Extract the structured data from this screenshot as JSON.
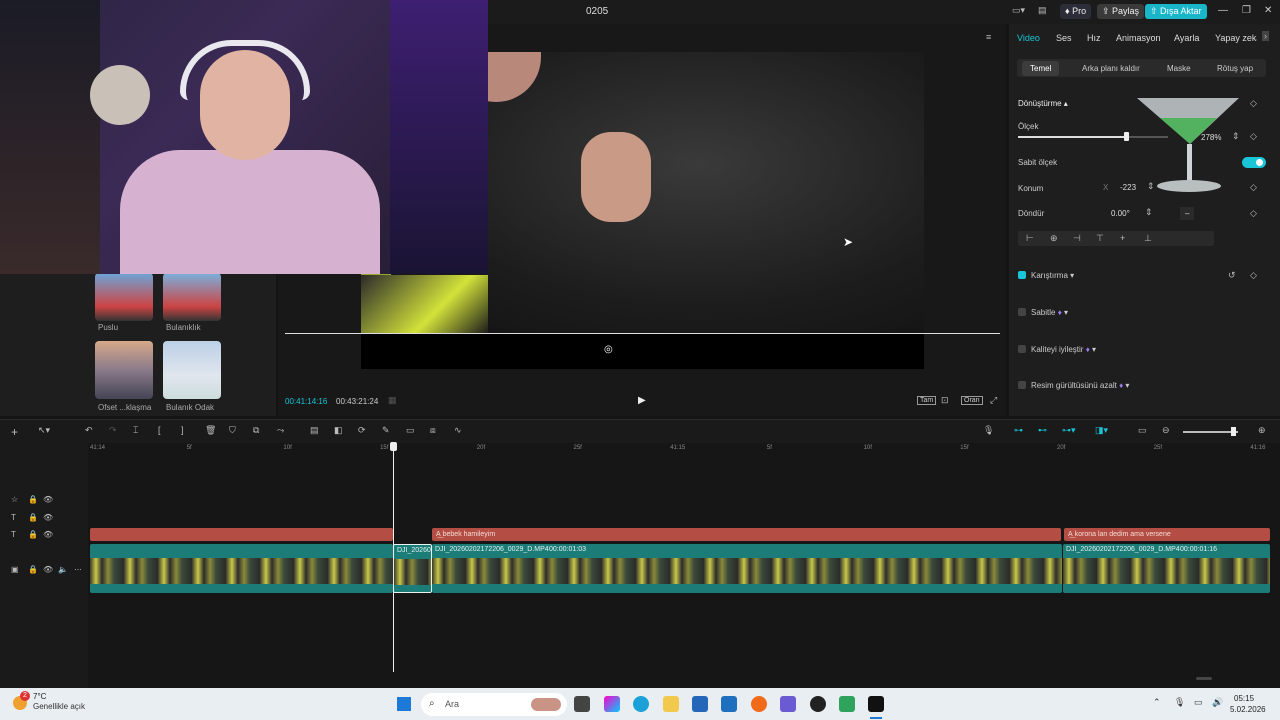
{
  "window": {
    "title": "0205",
    "pro_label": "Pro",
    "share_label": "Paylaş",
    "export_label": "Dışa Aktar"
  },
  "left_panel": {
    "items": [
      {
        "label": "Puslu"
      },
      {
        "label": "Bulanıklık"
      },
      {
        "label": "Ofset ...klaşma"
      },
      {
        "label": "Bulanık Odak"
      }
    ]
  },
  "player": {
    "time_current": "00:41:14:16",
    "time_total": "00:43:21:24",
    "controls": {
      "full": "Tam",
      "ratio": "Oran"
    }
  },
  "inspector": {
    "tabs": [
      "Video",
      "Ses",
      "Hız",
      "Animasyon",
      "Ayarla",
      "Yapay zekâ"
    ],
    "subtabs": [
      "Temel",
      "Arka planı kaldır",
      "Maske",
      "Rötuş yap"
    ],
    "transform_label": "Dönüştürme",
    "scale_label": "Ölçek",
    "scale_value": "278%",
    "scale_fraction": 0.72,
    "uniform_scale_label": "Sabit ölçek",
    "position_label": "Konum",
    "position_x_label": "X",
    "position_x": "-223",
    "rotate_label": "Döndür",
    "rotate_value": "0.00°",
    "rotate_dash": "–",
    "blend_label": "Karıştırma",
    "stabilize_label": "Sabitle",
    "enhance_label": "Kaliteyi iyileştir",
    "denoise_label": "Resim gürültüsünü azalt",
    "accent": "#19c5d6"
  },
  "timeline": {
    "ruler": [
      "41:14",
      "5f",
      "10f",
      "15f",
      "20f",
      "25f",
      "41:15",
      "5f",
      "10f",
      "15f",
      "20f",
      "25f",
      "41:16"
    ],
    "text_clips": [
      {
        "label": "bebek hamileyim"
      },
      {
        "label": "korona lan dedim ama versene"
      }
    ],
    "video_clips": [
      {
        "name": "DJI_20260",
        "duration": ""
      },
      {
        "name": "DJI_20260202172206_0029_D.MP4",
        "duration": "00:00:01:03"
      },
      {
        "name": "DJI_20260202172206_0029_D.MP4",
        "duration": "00:00:01:16"
      }
    ],
    "clip_color": "#1b7c78",
    "text_clip_color": "#b44d43"
  },
  "taskbar": {
    "temperature": "7°C",
    "weather": "Genellikle açık",
    "search_placeholder": "Ara",
    "time": "05:15",
    "date": "5.02.2026",
    "notification_badge": "2"
  }
}
